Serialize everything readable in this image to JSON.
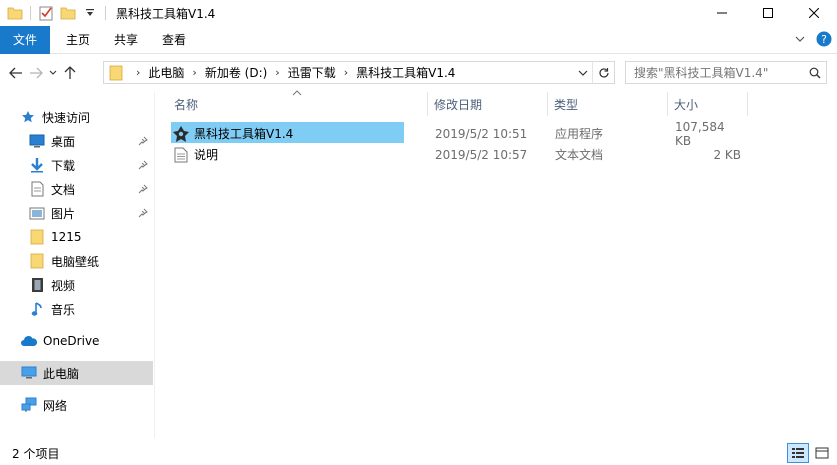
{
  "window": {
    "title": "黑科技工具箱V1.4"
  },
  "ribbon": {
    "tabs": [
      {
        "label": "文件"
      },
      {
        "label": "主页"
      },
      {
        "label": "共享"
      },
      {
        "label": "查看"
      }
    ]
  },
  "address": {
    "crumbs": [
      "此电脑",
      "新加卷 (D:)",
      "迅雷下载",
      "黑科技工具箱V1.4"
    ]
  },
  "search": {
    "placeholder": "搜索\"黑科技工具箱V1.4\""
  },
  "navpane": {
    "quick_access": "快速访问",
    "items": [
      {
        "label": "桌面",
        "icon": "desktop-icon",
        "pinned": true
      },
      {
        "label": "下载",
        "icon": "download-icon",
        "pinned": true
      },
      {
        "label": "文档",
        "icon": "document-icon",
        "pinned": true
      },
      {
        "label": "图片",
        "icon": "picture-icon",
        "pinned": true
      },
      {
        "label": "1215",
        "icon": "folder-icon",
        "pinned": false
      },
      {
        "label": "电脑壁纸",
        "icon": "folder-icon",
        "pinned": false
      },
      {
        "label": "视频",
        "icon": "video-icon",
        "pinned": false
      },
      {
        "label": "音乐",
        "icon": "music-icon",
        "pinned": false
      }
    ],
    "onedrive": "OneDrive",
    "this_pc": "此电脑",
    "network": "网络"
  },
  "columns": {
    "name": "名称",
    "modified": "修改日期",
    "type": "类型",
    "size": "大小"
  },
  "files": [
    {
      "name": "黑科技工具箱V1.4",
      "modified": "2019/5/2 10:51",
      "type": "应用程序",
      "size": "107,584 KB",
      "icon": "application-icon"
    },
    {
      "name": "说明",
      "modified": "2019/5/2 10:57",
      "type": "文本文档",
      "size": "2 KB",
      "icon": "text-file-icon"
    }
  ],
  "status": {
    "count": "2 个项目"
  },
  "colors": {
    "accent": "#1979ca",
    "selection": "#7fcdf5",
    "folder": "#f8d775"
  }
}
